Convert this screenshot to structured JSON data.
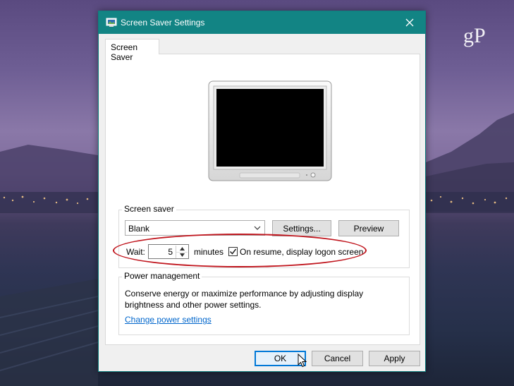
{
  "window": {
    "title": "Screen Saver Settings",
    "close_icon": "close-icon",
    "app_icon": "screensaver-app-icon"
  },
  "tabs": [
    {
      "label": "Screen Saver",
      "selected": true
    }
  ],
  "screen_saver": {
    "group_label": "Screen saver",
    "selected": "Blank",
    "settings_button": "Settings...",
    "preview_button": "Preview",
    "wait_label": "Wait:",
    "wait_value": "5",
    "minutes_label": "minutes",
    "resume_checkbox_label": "On resume, display logon screen",
    "resume_checked": true
  },
  "power_management": {
    "group_label": "Power management",
    "description": "Conserve energy or maximize performance by adjusting display brightness and other power settings.",
    "link": "Change power settings"
  },
  "footer": {
    "ok_label": "OK",
    "cancel_label": "Cancel",
    "apply_label": "Apply"
  },
  "watermark": {
    "text": "gP"
  },
  "colors": {
    "titlebar": "#128484",
    "highlight": "#c0151d",
    "link": "#0066cc",
    "focus": "#0078d7"
  }
}
